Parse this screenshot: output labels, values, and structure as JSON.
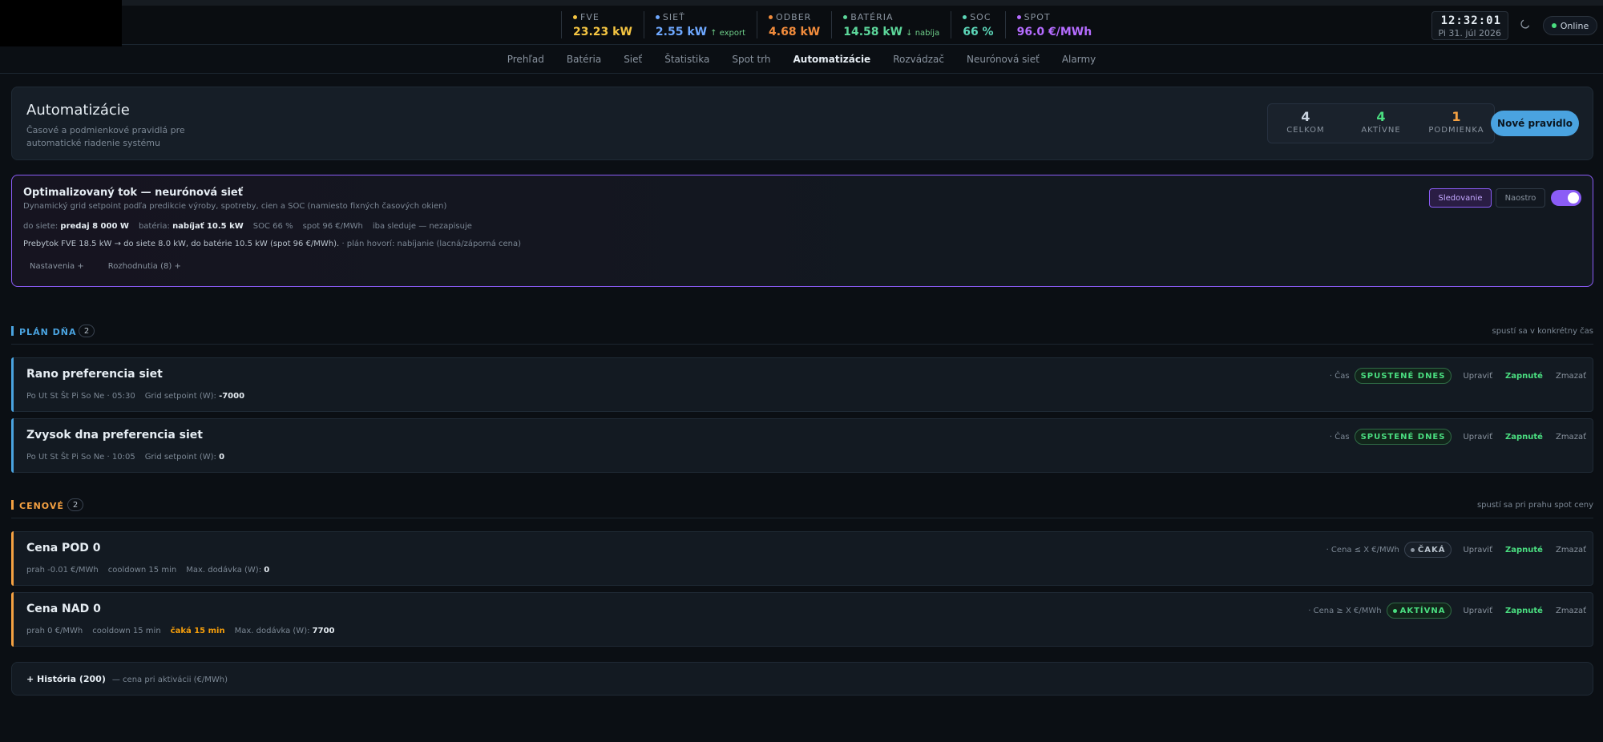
{
  "topbar": {
    "metrics": [
      {
        "label": "FVE",
        "value": "23.23 kW",
        "sub": "",
        "color": "#f5c542"
      },
      {
        "label": "SIEŤ",
        "value": "2.55 kW",
        "sub": "↑ export",
        "color": "#6ea8ff"
      },
      {
        "label": "ODBER",
        "value": "4.68 kW",
        "sub": "",
        "color": "#f28c3c"
      },
      {
        "label": "BATÉRIA",
        "value": "14.58 kW",
        "sub": "↓ nabíja",
        "color": "#5cd69a"
      },
      {
        "label": "SOC",
        "value": "66 %",
        "sub": "",
        "color": "#5cd6b8"
      },
      {
        "label": "SPOT",
        "value": "96.0 €/MWh",
        "sub": "",
        "color": "#b56cff"
      }
    ],
    "clock_time": "12:32:01",
    "clock_date": "Pi 31. júl 2026",
    "online": "Online"
  },
  "nav": {
    "tabs": [
      "Prehľad",
      "Batéria",
      "Sieť",
      "Štatistika",
      "Spot trh",
      "Automatizácie",
      "Rozvádzač",
      "Neurónová sieť",
      "Alarmy"
    ],
    "active": "Automatizácie"
  },
  "header": {
    "title": "Automatizácie",
    "desc": "Časové a podmienkové pravidlá pre automatické riadenie systému",
    "stats": [
      {
        "n": "4",
        "l": "CELKOM",
        "color": "#cbd5e1"
      },
      {
        "n": "4",
        "l": "AKTÍVNE",
        "color": "#4ade80"
      },
      {
        "n": "1",
        "l": "PODMIENKA",
        "color": "#f5a142"
      }
    ],
    "new_button": "Nové pravidlo"
  },
  "neural": {
    "title": "Optimalizovaný tok — neurónová sieť",
    "desc": "Dynamický grid setpoint podľa predikcie výroby, spotreby, cien a SOC (namiesto fixných časových okien)",
    "grid_label": "do siete:",
    "grid_value": "predaj 8 000 W",
    "battery_label": "batéria:",
    "battery_value": "nabíjať 10.5 kW",
    "soc": "SOC 66 %",
    "spot": "spot 96 €/MWh",
    "mode": "iba sleduje — nezapisuje",
    "summary": "Prebytok FVE 18.5 kW → do siete 8.0 kW, do batérie 10.5 kW (spot 96 €/MWh).",
    "plan": "· plán hovorí: nabíjanie (lacná/záporná cena)",
    "settings_link": "Nastavenia +",
    "decisions_link": "Rozhodnutia (8) +",
    "btn_track": "Sledovanie",
    "btn_sharp": "Naostro"
  },
  "sections": {
    "plan": {
      "name": "PLÁN DŇA",
      "count": "2",
      "hint": "spustí sa v konkrétny čas"
    },
    "price": {
      "name": "CENOVÉ",
      "count": "2",
      "hint": "spustí sa pri prahu spot ceny"
    }
  },
  "rules": [
    {
      "title": "Rano preferencia siet",
      "meta1": "Po Ut St Št Pi So Ne · 05:30",
      "meta2_label": "Grid setpoint (W):",
      "meta2_value": "-7000",
      "type": "· Čas",
      "badge": "SPUSTENÉ DNES",
      "edit": "Upraviť",
      "on": "Zapnuté",
      "del": "Zmazať"
    },
    {
      "title": "Zvysok dna preferencia siet",
      "meta1": "Po Ut St Št Pi So Ne · 10:05",
      "meta2_label": "Grid setpoint (W):",
      "meta2_value": "0",
      "type": "· Čas",
      "badge": "SPUSTENÉ DNES",
      "edit": "Upraviť",
      "on": "Zapnuté",
      "del": "Zmazať"
    },
    {
      "title": "Cena POD 0",
      "meta1": "prah -0.01 €/MWh",
      "meta_cd": "cooldown 15 min",
      "meta2_label": "Max. dodávka (W):",
      "meta2_value": "0",
      "type": "· Cena ≤ X €/MWh",
      "badge": "ČAKÁ",
      "edit": "Upraviť",
      "on": "Zapnuté",
      "del": "Zmazať"
    },
    {
      "title": "Cena NAD 0",
      "meta1": "prah 0 €/MWh",
      "meta_cd": "cooldown 15 min",
      "meta_wait": "čaká 15 min",
      "meta2_label": "Max. dodávka (W):",
      "meta2_value": "7700",
      "type": "· Cena ≥ X €/MWh",
      "badge": "AKTÍVNA",
      "edit": "Upraviť",
      "on": "Zapnuté",
      "del": "Zmazať"
    }
  ],
  "history": {
    "label": "+ História (200)",
    "sub": "— cena pri aktivácii (€/MWh)"
  }
}
